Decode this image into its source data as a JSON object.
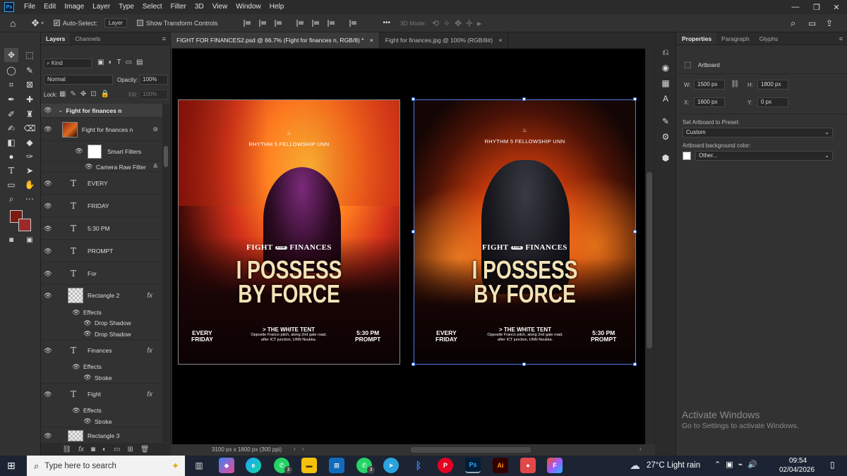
{
  "menu": {
    "logo": "Ps",
    "items": [
      "File",
      "Edit",
      "Image",
      "Layer",
      "Type",
      "Select",
      "Filter",
      "3D",
      "View",
      "Window",
      "Help"
    ],
    "window_controls": {
      "minimize": "—",
      "restore": "❐",
      "close": "✕"
    }
  },
  "options": {
    "auto_select_label": "Auto-Select:",
    "auto_select_value": "Layer",
    "transform_label": "Show Transform Controls",
    "more": "•••",
    "mode_3d": "3D Mode:"
  },
  "layers_panel": {
    "tabs": [
      "Layers",
      "Channels"
    ],
    "kind": "Kind",
    "blend_mode": "Normal",
    "opacity_label": "Opacity:",
    "opacity_value": "100%",
    "lock_label": "Lock:",
    "fill_label": "Fill:",
    "fill_value": "100%",
    "group_name": "Fight for finances n",
    "rows": [
      {
        "name": "Fight for finances n"
      },
      {
        "name": "Smart Filters"
      },
      {
        "name": "Camera Raw Filter"
      },
      {
        "name": "EVERY"
      },
      {
        "name": "FRIDAY"
      },
      {
        "name": "5:30 PM"
      },
      {
        "name": "PROMPT"
      },
      {
        "name": "For"
      },
      {
        "name": "Rectangle 2"
      },
      {
        "name": "Effects"
      },
      {
        "name": "Drop Shadow"
      },
      {
        "name": "Drop Shadow"
      },
      {
        "name": "Finances"
      },
      {
        "name": "Effects"
      },
      {
        "name": "Stroke"
      },
      {
        "name": "Fight"
      },
      {
        "name": "Effects"
      },
      {
        "name": "Stroke"
      },
      {
        "name": "Rectangle 3"
      }
    ]
  },
  "documents": {
    "tab1": "FIGHT FOR FINANCES2.psd @ 66.7% (Fight for finances n, RGB/8) *",
    "tab2": "Fight for finances.jpg @ 100% (RGB/8#)"
  },
  "poster": {
    "org": "RHYTHM 5 FELLOWSHIP UNN",
    "fight": "FIGHT",
    "for": "FOR",
    "finances": "FINANCES",
    "headline1": "I POSSESS",
    "headline2": "BY FORCE",
    "day1": "EVERY",
    "day2": "FRIDAY",
    "venue_title": "> THE WHITE TENT",
    "venue_detail": "Opposite Franco pitch, along 2nd gate road, after ICT junction, UNN Nsukka.",
    "time1": "5:30 PM",
    "time2": "PROMPT"
  },
  "status": {
    "doc_size": "3100 px x 1800 px (300 ppi)"
  },
  "properties": {
    "tabs": [
      "Properties",
      "Paragraph",
      "Glyphs"
    ],
    "section": "Artboard",
    "w_label": "W:",
    "w_value": "1500 px",
    "h_label": "H:",
    "h_value": "1800 px",
    "x_label": "X:",
    "x_value": "1600 px",
    "y_label": "Y:",
    "y_value": "0 px",
    "preset_label": "Set Artboard to Preset:",
    "preset_value": "Custom",
    "bg_label": "Artboard background color:",
    "bg_value": "Other..."
  },
  "watermark": {
    "title": "Activate Windows",
    "subtitle": "Go to Settings to activate Windows."
  },
  "taskbar": {
    "search_placeholder": "Type here to search",
    "weather": "27°C  Light rain",
    "time": "09:54",
    "date": "02/04/2026",
    "badge1": "3",
    "badge2": "3"
  },
  "colors": {
    "foreground": "#7a1a12",
    "background": "#9c2a2a",
    "selection": "#4a7fe8",
    "photoshop": "#31a8ff"
  }
}
